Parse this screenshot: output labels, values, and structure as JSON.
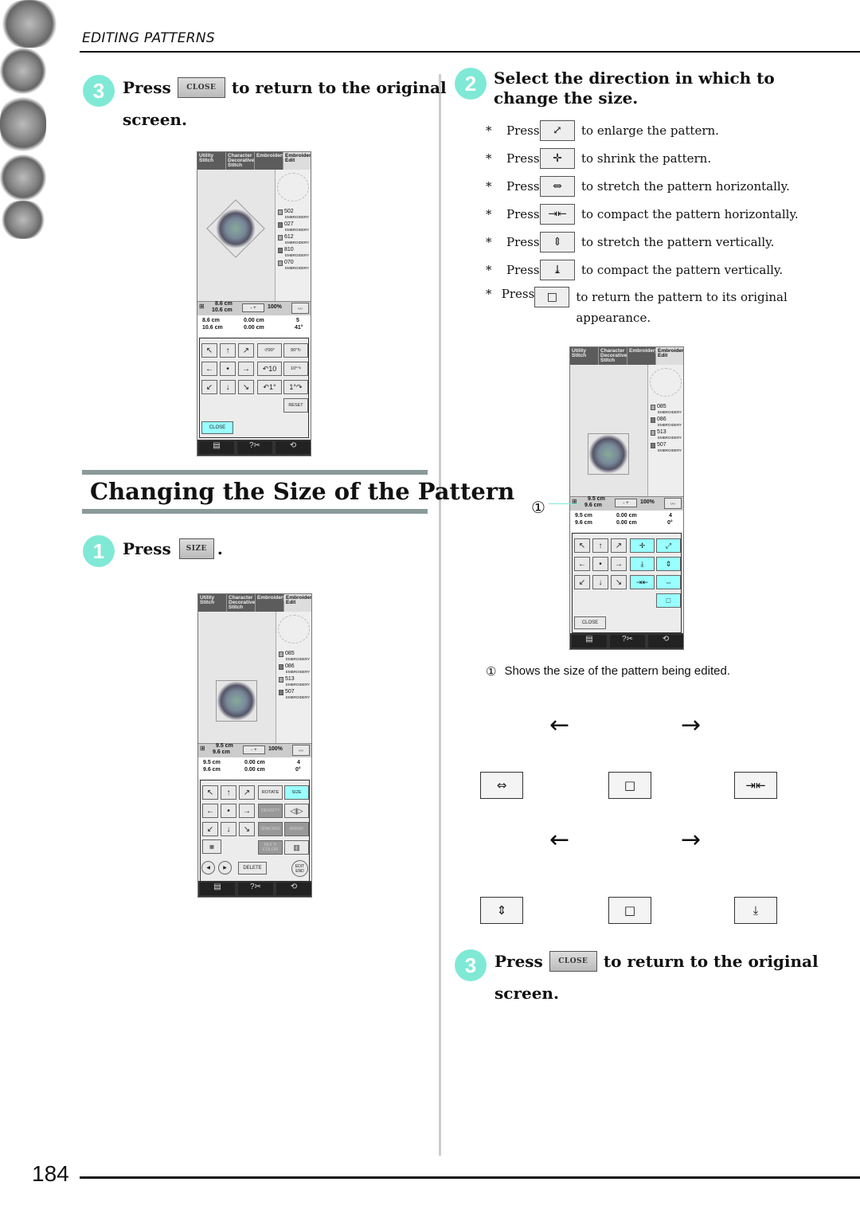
{
  "header": {
    "section": "EDITING PATTERNS",
    "page_number": "184"
  },
  "colors": {
    "step_badge": "#7fe9d6",
    "screen_highlight": "#99ffff",
    "section_rule": "#8a9a9a"
  },
  "left": {
    "step3": {
      "num": "3",
      "press": "Press",
      "button": "CLOSE",
      "text": "to return to the original",
      "text2": "screen."
    },
    "section_title": "Changing the Size of the Pattern",
    "step1": {
      "num": "1",
      "press": "Press",
      "button": "SIZE",
      "suffix": "."
    }
  },
  "right": {
    "step2": {
      "num": "2",
      "title": "Select the direction in which to change the size."
    },
    "items": [
      {
        "bullet": "*",
        "press": "Press",
        "icon": "enlarge-icon",
        "glyph": "⤢",
        "text": "to enlarge the pattern."
      },
      {
        "bullet": "*",
        "press": "Press",
        "icon": "shrink-icon",
        "glyph": "✛",
        "text": "to shrink the pattern."
      },
      {
        "bullet": "*",
        "press": "Press",
        "icon": "stretch-horizontal-icon",
        "glyph": "⇔",
        "text": "to stretch the pattern horizontally."
      },
      {
        "bullet": "*",
        "press": "Press",
        "icon": "compact-horizontal-icon",
        "glyph": "⇥⇤",
        "text": "to compact the pattern horizontally."
      },
      {
        "bullet": "*",
        "press": "Press",
        "icon": "stretch-vertical-icon",
        "glyph": "⇕",
        "text": "to stretch the pattern vertically."
      },
      {
        "bullet": "*",
        "press": "Press",
        "icon": "compact-vertical-icon",
        "glyph": "⤓",
        "text": "to compact the pattern vertically."
      },
      {
        "bullet": "*",
        "press": "Press",
        "icon": "original-size-icon",
        "glyph": "□",
        "text": "to return the pattern to its original appearance."
      }
    ],
    "callout_num": "①",
    "callout_text": "Shows the size of the pattern being edited.",
    "step3": {
      "num": "3",
      "press": "Press",
      "button": "CLOSE",
      "text": "to return to the original",
      "text2": "screen."
    }
  },
  "screens": [
    {
      "tabs": [
        "Utility Stitch",
        "Character Decorative Stitch",
        "Embroidery",
        "Embroidery Edit"
      ],
      "threads": [
        {
          "code": "502",
          "name": "EMBROIDERY"
        },
        {
          "code": "027",
          "name": "EMBROIDERY"
        },
        {
          "code": "612",
          "name": "EMBROIDERY"
        },
        {
          "code": "810",
          "name": "EMBROIDERY"
        },
        {
          "code": "070",
          "name": "EMBROIDERY"
        }
      ],
      "size_h": "8.6 cm",
      "size_w": "10.6 cm",
      "zoom": "100%",
      "info": {
        "h": "8.6 cm",
        "w": "10.6 cm",
        "dy": "0.00 cm",
        "dx": "0.00 cm",
        "colors": "5",
        "angle": "41°"
      },
      "arrows": [
        "↖",
        "↑",
        "↗",
        "←",
        "•",
        "→",
        "↙",
        "↓",
        "↘"
      ],
      "right_buttons": [
        "↺90°",
        "90°↻",
        "↶10",
        "10°↷",
        "↶1°",
        "1°↷",
        "",
        "RESET"
      ],
      "right_states": [
        "n",
        "n",
        "n",
        "n",
        "n",
        "n",
        "x",
        "n"
      ],
      "close": "CLOSE",
      "close_state": "cy",
      "extra": []
    },
    {
      "tabs": [
        "Utility Stitch",
        "Character Decorative Stitch",
        "Embroidery",
        "Embroidery Edit"
      ],
      "threads": [
        {
          "code": "085",
          "name": "EMBROIDERY"
        },
        {
          "code": "086",
          "name": "EMBROIDERY"
        },
        {
          "code": "513",
          "name": "EMBROIDERY"
        },
        {
          "code": "507",
          "name": "EMBROIDERY"
        }
      ],
      "size_h": "9.5 cm",
      "size_w": "9.6 cm",
      "zoom": "100%",
      "info": {
        "h": "9.5 cm",
        "w": "9.6 cm",
        "dy": "0.00 cm",
        "dx": "0.00 cm",
        "colors": "4",
        "angle": "0°"
      },
      "arrows": [
        "↖",
        "↑",
        "↗",
        "←",
        "•",
        "→",
        "↙",
        "↓",
        "↘"
      ],
      "right_buttons": [
        "ROTATE",
        "SIZE",
        "DENSITY",
        "◁|▷",
        "SPACING",
        "ARRAY",
        "MULTI COLOR",
        "▥"
      ],
      "right_states": [
        "n",
        "cy",
        "dis",
        "n",
        "dis",
        "dis",
        "dis",
        "n"
      ],
      "close": "",
      "close_state": "x",
      "extra": [
        "◀",
        "▶",
        "DELETE",
        "EDIT END"
      ]
    },
    {
      "tabs": [
        "Utility Stitch",
        "Character Decorative Stitch",
        "Embroidery",
        "Embroidery Edit"
      ],
      "threads": [
        {
          "code": "085",
          "name": "EMBROIDERY"
        },
        {
          "code": "086",
          "name": "EMBROIDERY"
        },
        {
          "code": "513",
          "name": "EMBROIDERY"
        },
        {
          "code": "507",
          "name": "EMBROIDERY"
        }
      ],
      "size_h": "9.5 cm",
      "size_w": "9.6 cm",
      "zoom": "100%",
      "info": {
        "h": "9.5 cm",
        "w": "9.6 cm",
        "dy": "0.00 cm",
        "dx": "0.00 cm",
        "colors": "4",
        "angle": "0°"
      },
      "arrows": [
        "↖",
        "↑",
        "↗",
        "←",
        "•",
        "→",
        "↙",
        "↓",
        "↘"
      ],
      "right_buttons": [
        "✛",
        "⤢",
        "⤓",
        "⇕",
        "⇥⇤",
        "⇔",
        "",
        "□"
      ],
      "right_states": [
        "cy",
        "cy",
        "cy",
        "cy",
        "cy",
        "cy",
        "x",
        "cy"
      ],
      "close": "CLOSE",
      "close_state": "n",
      "extra": []
    }
  ],
  "illustrations": {
    "buttons": [
      "⇔",
      "□",
      "⇥⇤",
      "⇕",
      "□",
      "⤓"
    ],
    "arrow_left": "←",
    "arrow_right": "→"
  }
}
